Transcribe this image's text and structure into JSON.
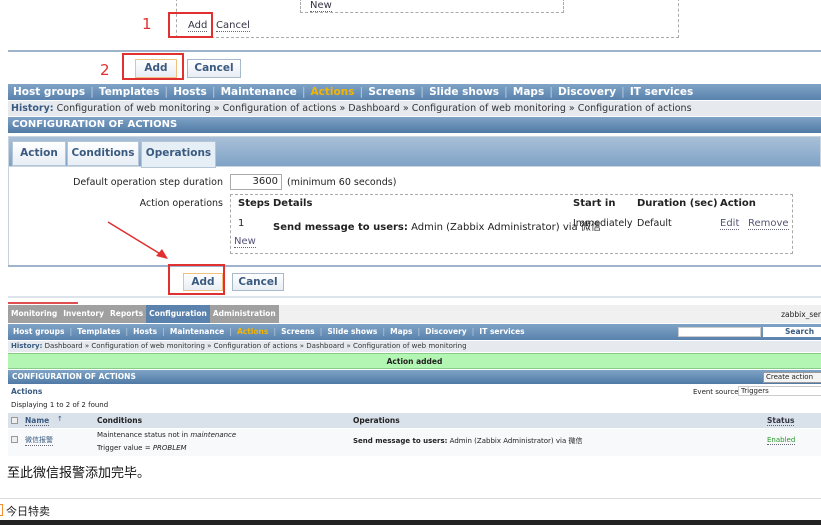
{
  "top": {
    "new_link": "New",
    "step1": "1",
    "add": "Add",
    "cancel": "Cancel",
    "step2": "2"
  },
  "nav1": [
    "Host groups",
    "Templates",
    "Hosts",
    "Maintenance",
    "Actions",
    "Screens",
    "Slide shows",
    "Maps",
    "Discovery",
    "IT services"
  ],
  "history1": {
    "label": "History:",
    "items": "Configuration of web monitoring » Configuration of actions » Dashboard » Configuration of web monitoring » Configuration of actions"
  },
  "header1": "CONFIGURATION OF ACTIONS",
  "tabs": [
    "Action",
    "Conditions",
    "Operations"
  ],
  "form": {
    "step_duration_label": "Default operation step duration",
    "step_duration_value": "3600",
    "step_duration_hint": "(minimum 60 seconds)",
    "operations_label": "Action operations",
    "columns": [
      "Steps",
      "Details",
      "Start in",
      "Duration (sec)",
      "Action"
    ],
    "row": {
      "step": "1",
      "details_bold": "Send message to users:",
      "details": " Admin (Zabbix Administrator) via 微信",
      "start": "Immediately",
      "duration": "Default",
      "edit": "Edit",
      "remove": "Remove"
    },
    "new": "New"
  },
  "bottom_buttons": {
    "add": "Add",
    "cancel": "Cancel"
  },
  "shot2": {
    "menu": [
      "Monitoring",
      "Inventory",
      "Reports",
      "Configuration",
      "Administration"
    ],
    "server": "zabbix_ser",
    "nav": [
      "Host groups",
      "Templates",
      "Hosts",
      "Maintenance",
      "Actions",
      "Screens",
      "Slide shows",
      "Maps",
      "Discovery",
      "IT services"
    ],
    "search_button": "Search",
    "history_label": "History:",
    "history": "Dashboard » Configuration of web monitoring » Configuration of actions » Dashboard » Configuration of web monitoring",
    "message": "Action added",
    "header": "CONFIGURATION OF ACTIONS",
    "create_button": "Create action",
    "actions_title": "Actions",
    "event_source_label": "Event source",
    "event_source_value": "Triggers",
    "displaying": "Displaying 1 to 2 of 2 found",
    "columns": [
      "Name",
      "Conditions",
      "Operations",
      "Status"
    ],
    "row": {
      "name": "微信报警",
      "cond1": "Maintenance status not in ",
      "cond1_em": "maintenance",
      "cond2": "Trigger value = ",
      "cond2_em": "PROBLEM",
      "ops_bold": "Send message to users:",
      "ops": " Admin (Zabbix Administrator) via 微信",
      "status": "Enabled"
    }
  },
  "caption": "至此微信报警添加完毕。",
  "footer": "今日特卖",
  "colors": {
    "accent": "#5a82ad",
    "active_nav": "#f4b400",
    "annotation": "#e03030",
    "success": "#b3f5b3"
  }
}
